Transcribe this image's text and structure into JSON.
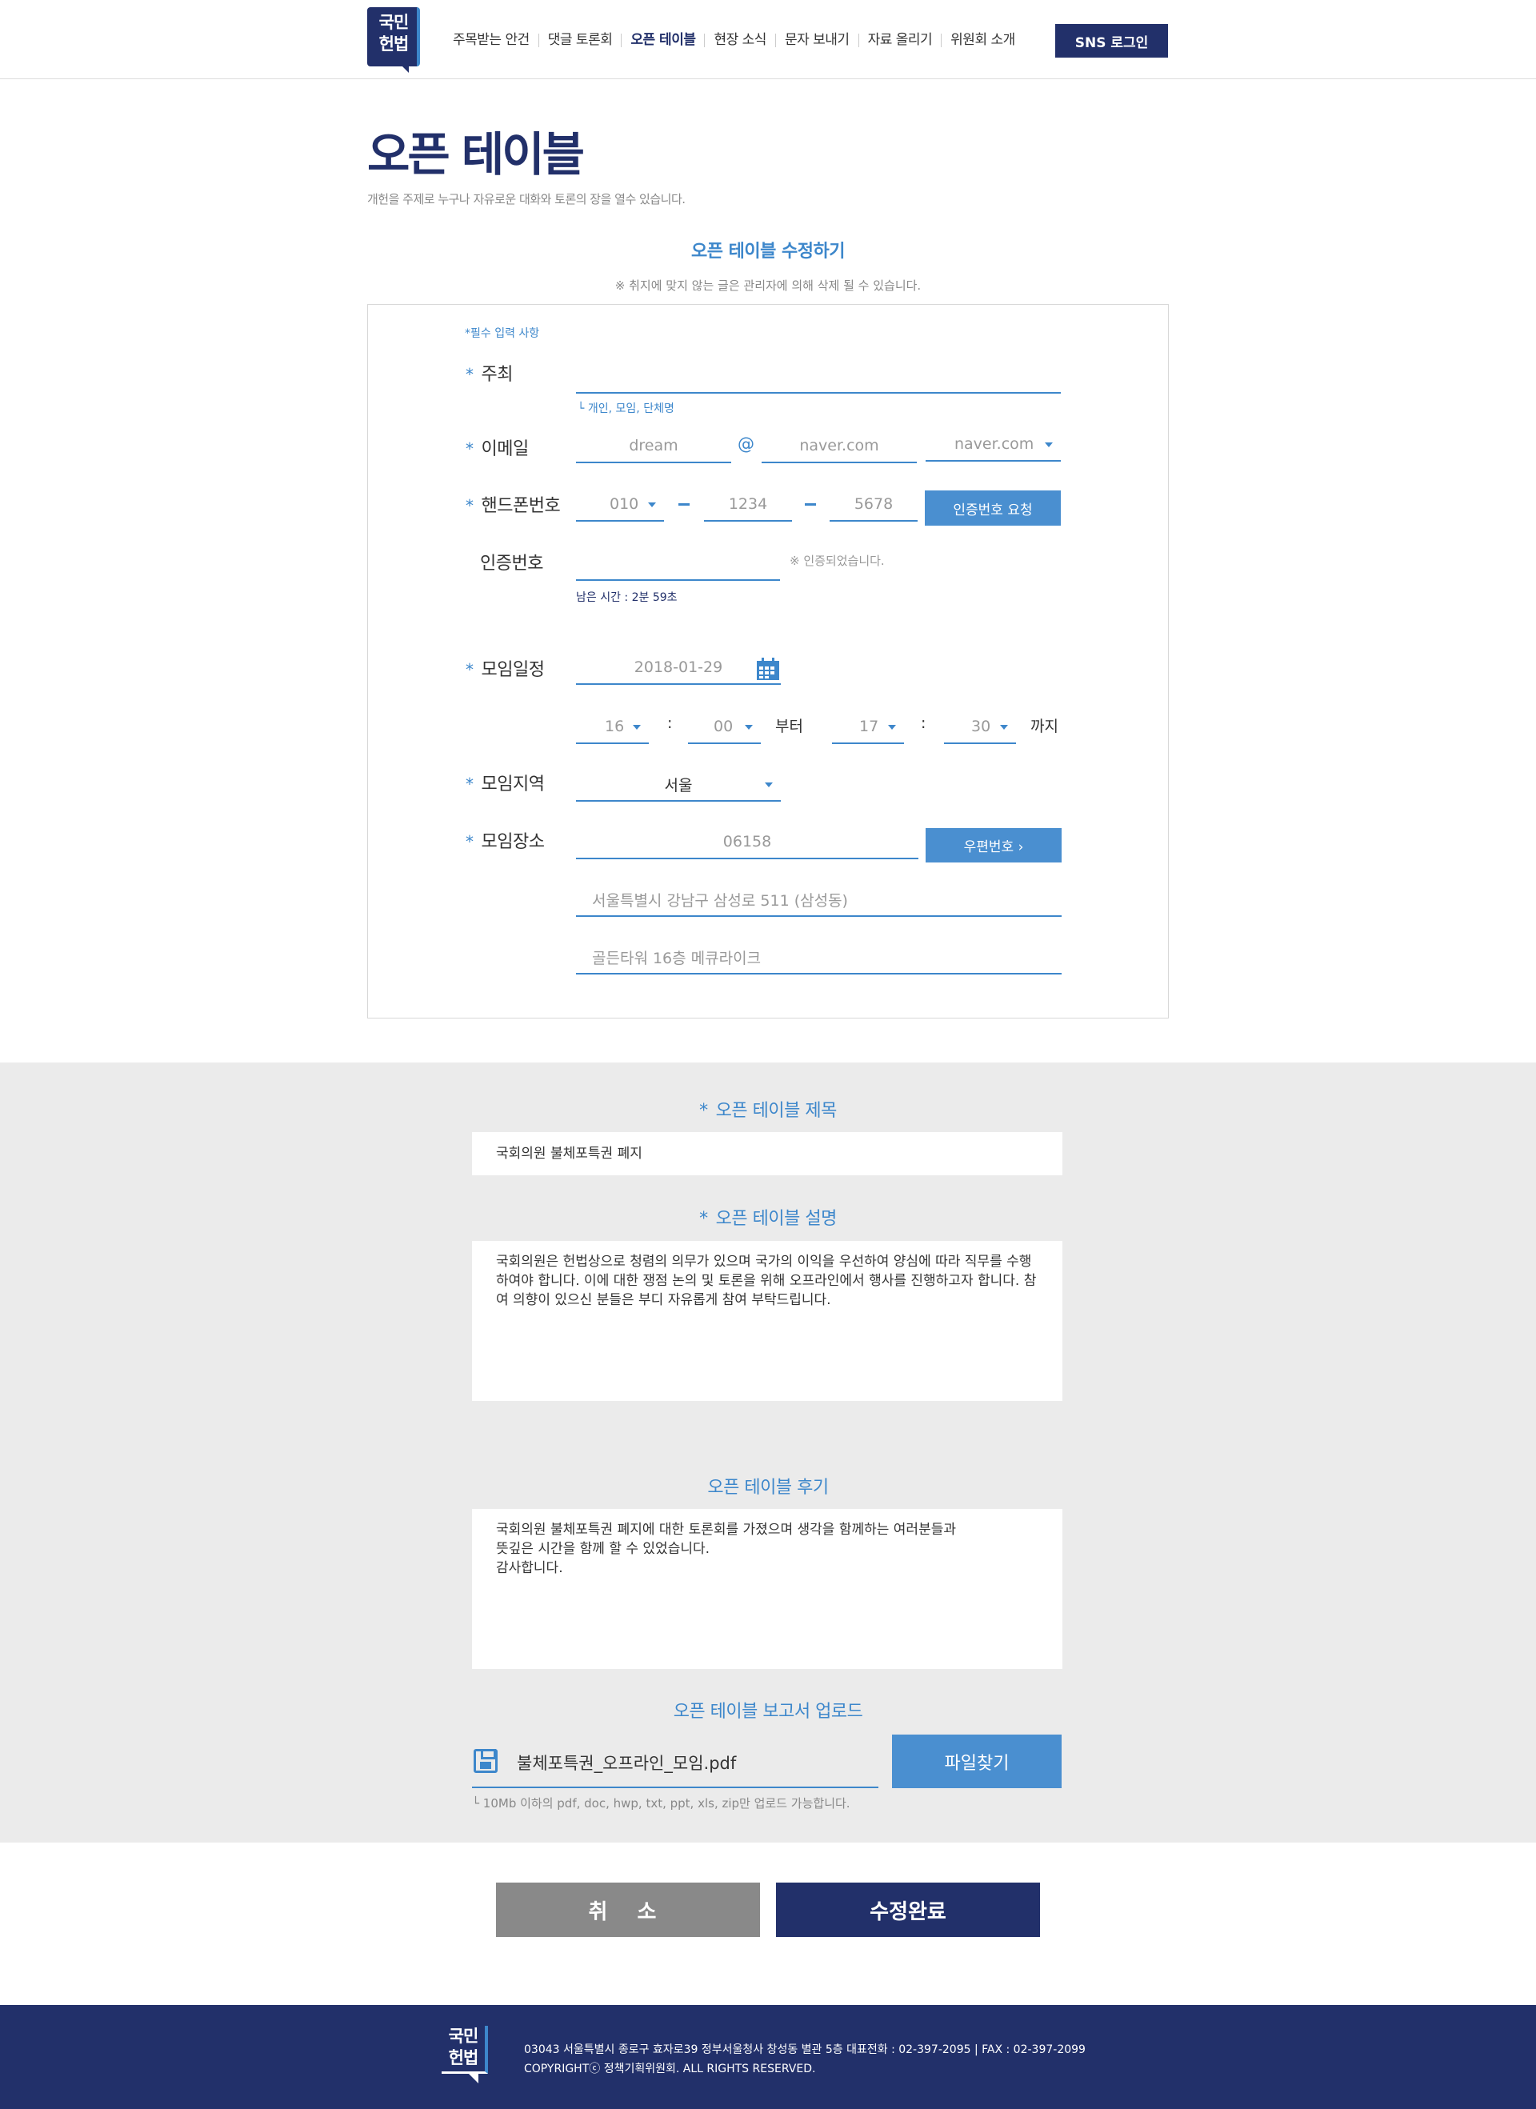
{
  "header": {
    "logo_line1": "국민",
    "logo_line2": "헌법",
    "nav": [
      "주목받는 안건",
      "댓글 토론회",
      "오픈 테이블",
      "현장 소식",
      "문자 보내기",
      "자료 올리기",
      "위원회 소개"
    ],
    "active_nav": "오픈 테이블",
    "sns_login": "SNS 로그인"
  },
  "page": {
    "title": "오픈 테이블",
    "subtitle": "개헌을 주제로 누구나 자유로운 대화와 토론의 장을 열수 있습니다.",
    "section_title": "오픈 테이블 수정하기",
    "notice": "※ 취지에 맞지 않는 글은 관리자에 의해 삭제 될 수 있습니다."
  },
  "form": {
    "required_note": "*필수 입력 사항",
    "host": {
      "label": "주최",
      "value": "",
      "hint": "└ 개인, 모임, 단체명"
    },
    "email": {
      "label": "이메일",
      "id": "dream",
      "at": "@",
      "domain": "naver.com",
      "domain_select": "naver.com"
    },
    "phone": {
      "label": "핸드폰번호",
      "p1": "010",
      "p2": "1234",
      "p3": "5678",
      "button": "인증번호 요청"
    },
    "verify": {
      "label": "인증번호",
      "value": "",
      "status": "※ 인증되었습니다.",
      "remaining": "남은 시간 : 2분 59초"
    },
    "schedule": {
      "label": "모임일정",
      "date": "2018-01-29",
      "start_hour": "16",
      "start_min": "00",
      "colon": ":",
      "from": "부터",
      "end_hour": "17",
      "end_min": "30",
      "until": "까지"
    },
    "region": {
      "label": "모임지역",
      "value": "서울"
    },
    "place": {
      "label": "모임장소",
      "zipcode": "06158",
      "zip_button": "우편번호 ›",
      "address1": "서울특별시 강남구 삼성로 511 (삼성동)",
      "address2": "골든타워 16층 메큐라이크"
    }
  },
  "details": {
    "title_label": "오픈 테이블 제목",
    "title_value": "국회의원 불체포특권 폐지",
    "desc_label": "오픈 테이블 설명",
    "desc_value": "국회의원은 헌법상으로 청렴의 의무가 있으며 국가의 이익을 우선하여 양심에 따라 직무를 수행하여야 합니다. 이에 대한 쟁점 논의 및 토론을 위해 오프라인에서 행사를 진행하고자 합니다. 참여 의향이 있으신 분들은 부디 자유롭게 참여 부탁드립니다.",
    "review_label": "오픈 테이블 후기",
    "review_line1": "국회의원 불체포특권 폐지에 대한 토론회를 가졌으며 생각을 함께하는 여러분들과",
    "review_line2": "뜻깊은 시간을 함께 할 수 있었습니다.",
    "review_line3": "감사합니다.",
    "upload_label": "오픈 테이블 보고서 업로드",
    "file_name": "불체포특권_오프라인_모임.pdf",
    "file_button": "파일찾기",
    "file_note": "└ 10Mb 이하의 pdf, doc, hwp, txt, ppt, xls, zip만 업로드 가능합니다."
  },
  "actions": {
    "cancel": "취 소",
    "submit": "수정완료"
  },
  "footer": {
    "address": "03043 서울특별시 종로구 효자로39 정부서울청사 창성동 별관 5층 대표전화 : 02-397-2095 | FAX : 02-397-2099",
    "copyright": "COPYRIGHTⓒ 정책기획위원회. ALL RIGHTS RESERVED."
  },
  "colors": {
    "navy": "#22306a",
    "accent": "#3d87cb",
    "gray_bg": "#ebebeb"
  }
}
